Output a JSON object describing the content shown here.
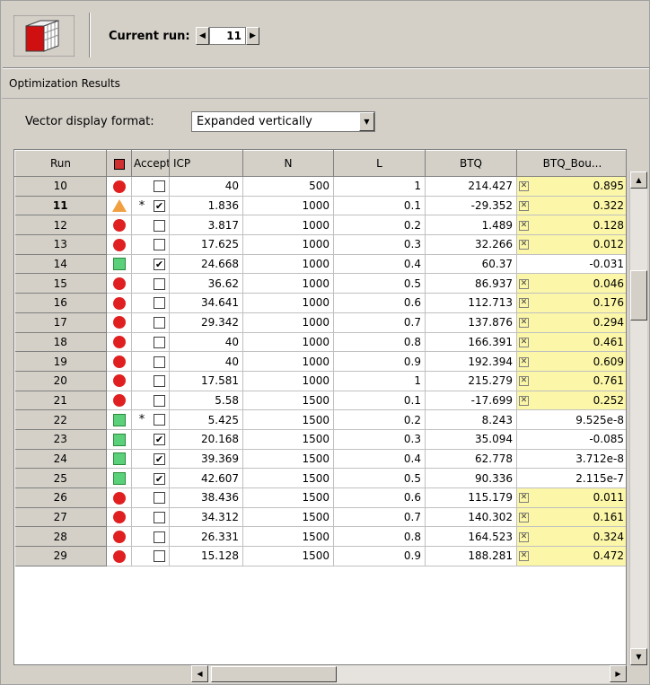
{
  "toolbar": {
    "current_run_label": "Current run:",
    "current_run_value": "11",
    "app_icon": "database-cube-icon"
  },
  "panel": {
    "title": "Optimization Results"
  },
  "vector": {
    "label": "Vector display format:",
    "selected": "Expanded vertically"
  },
  "table": {
    "columns": [
      "Run",
      "",
      "Accept",
      "ICP",
      "N",
      "L",
      "BTQ",
      "BTQ_Bou..."
    ],
    "rows": [
      {
        "run": "10",
        "status": "red-dot",
        "star": "",
        "accept": false,
        "icp": "40",
        "n": "500",
        "l": "1",
        "btq": "214.427",
        "btqb_flag": true,
        "btqb": "0.895"
      },
      {
        "run": "11",
        "status": "orange-triangle",
        "star": "*",
        "accept": true,
        "icp": "1.836",
        "n": "1000",
        "l": "0.1",
        "btq": "-29.352",
        "btqb_flag": true,
        "btqb": "0.322"
      },
      {
        "run": "12",
        "status": "red-dot",
        "star": "",
        "accept": false,
        "icp": "3.817",
        "n": "1000",
        "l": "0.2",
        "btq": "1.489",
        "btqb_flag": true,
        "btqb": "0.128"
      },
      {
        "run": "13",
        "status": "red-dot",
        "star": "",
        "accept": false,
        "icp": "17.625",
        "n": "1000",
        "l": "0.3",
        "btq": "32.266",
        "btqb_flag": true,
        "btqb": "0.012"
      },
      {
        "run": "14",
        "status": "green-square",
        "star": "",
        "accept": true,
        "icp": "24.668",
        "n": "1000",
        "l": "0.4",
        "btq": "60.37",
        "btqb_flag": false,
        "btqb": "-0.031"
      },
      {
        "run": "15",
        "status": "red-dot",
        "star": "",
        "accept": false,
        "icp": "36.62",
        "n": "1000",
        "l": "0.5",
        "btq": "86.937",
        "btqb_flag": true,
        "btqb": "0.046"
      },
      {
        "run": "16",
        "status": "red-dot",
        "star": "",
        "accept": false,
        "icp": "34.641",
        "n": "1000",
        "l": "0.6",
        "btq": "112.713",
        "btqb_flag": true,
        "btqb": "0.176"
      },
      {
        "run": "17",
        "status": "red-dot",
        "star": "",
        "accept": false,
        "icp": "29.342",
        "n": "1000",
        "l": "0.7",
        "btq": "137.876",
        "btqb_flag": true,
        "btqb": "0.294"
      },
      {
        "run": "18",
        "status": "red-dot",
        "star": "",
        "accept": false,
        "icp": "40",
        "n": "1000",
        "l": "0.8",
        "btq": "166.391",
        "btqb_flag": true,
        "btqb": "0.461"
      },
      {
        "run": "19",
        "status": "red-dot",
        "star": "",
        "accept": false,
        "icp": "40",
        "n": "1000",
        "l": "0.9",
        "btq": "192.394",
        "btqb_flag": true,
        "btqb": "0.609"
      },
      {
        "run": "20",
        "status": "red-dot",
        "star": "",
        "accept": false,
        "icp": "17.581",
        "n": "1000",
        "l": "1",
        "btq": "215.279",
        "btqb_flag": true,
        "btqb": "0.761"
      },
      {
        "run": "21",
        "status": "red-dot",
        "star": "",
        "accept": false,
        "icp": "5.58",
        "n": "1500",
        "l": "0.1",
        "btq": "-17.699",
        "btqb_flag": true,
        "btqb": "0.252"
      },
      {
        "run": "22",
        "status": "green-square",
        "star": "*",
        "accept": false,
        "icp": "5.425",
        "n": "1500",
        "l": "0.2",
        "btq": "8.243",
        "btqb_flag": false,
        "btqb": "9.525e-8"
      },
      {
        "run": "23",
        "status": "green-square",
        "star": "",
        "accept": true,
        "icp": "20.168",
        "n": "1500",
        "l": "0.3",
        "btq": "35.094",
        "btqb_flag": false,
        "btqb": "-0.085"
      },
      {
        "run": "24",
        "status": "green-square",
        "star": "",
        "accept": true,
        "icp": "39.369",
        "n": "1500",
        "l": "0.4",
        "btq": "62.778",
        "btqb_flag": false,
        "btqb": "3.712e-8"
      },
      {
        "run": "25",
        "status": "green-square",
        "star": "",
        "accept": true,
        "icp": "42.607",
        "n": "1500",
        "l": "0.5",
        "btq": "90.336",
        "btqb_flag": false,
        "btqb": "2.115e-7"
      },
      {
        "run": "26",
        "status": "red-dot",
        "star": "",
        "accept": false,
        "icp": "38.436",
        "n": "1500",
        "l": "0.6",
        "btq": "115.179",
        "btqb_flag": true,
        "btqb": "0.011"
      },
      {
        "run": "27",
        "status": "red-dot",
        "star": "",
        "accept": false,
        "icp": "34.312",
        "n": "1500",
        "l": "0.7",
        "btq": "140.302",
        "btqb_flag": true,
        "btqb": "0.161"
      },
      {
        "run": "28",
        "status": "red-dot",
        "star": "",
        "accept": false,
        "icp": "26.331",
        "n": "1500",
        "l": "0.8",
        "btq": "164.523",
        "btqb_flag": true,
        "btqb": "0.324"
      },
      {
        "run": "29",
        "status": "red-dot",
        "star": "",
        "accept": false,
        "icp": "15.128",
        "n": "1500",
        "l": "0.9",
        "btq": "188.281",
        "btqb_flag": true,
        "btqb": "0.472"
      }
    ],
    "selected_run": "11"
  },
  "colors": {
    "highlight_yellow": "#fbf6a8",
    "status_red": "#e02020",
    "status_green": "#5ad07a",
    "status_orange": "#f0a040"
  }
}
